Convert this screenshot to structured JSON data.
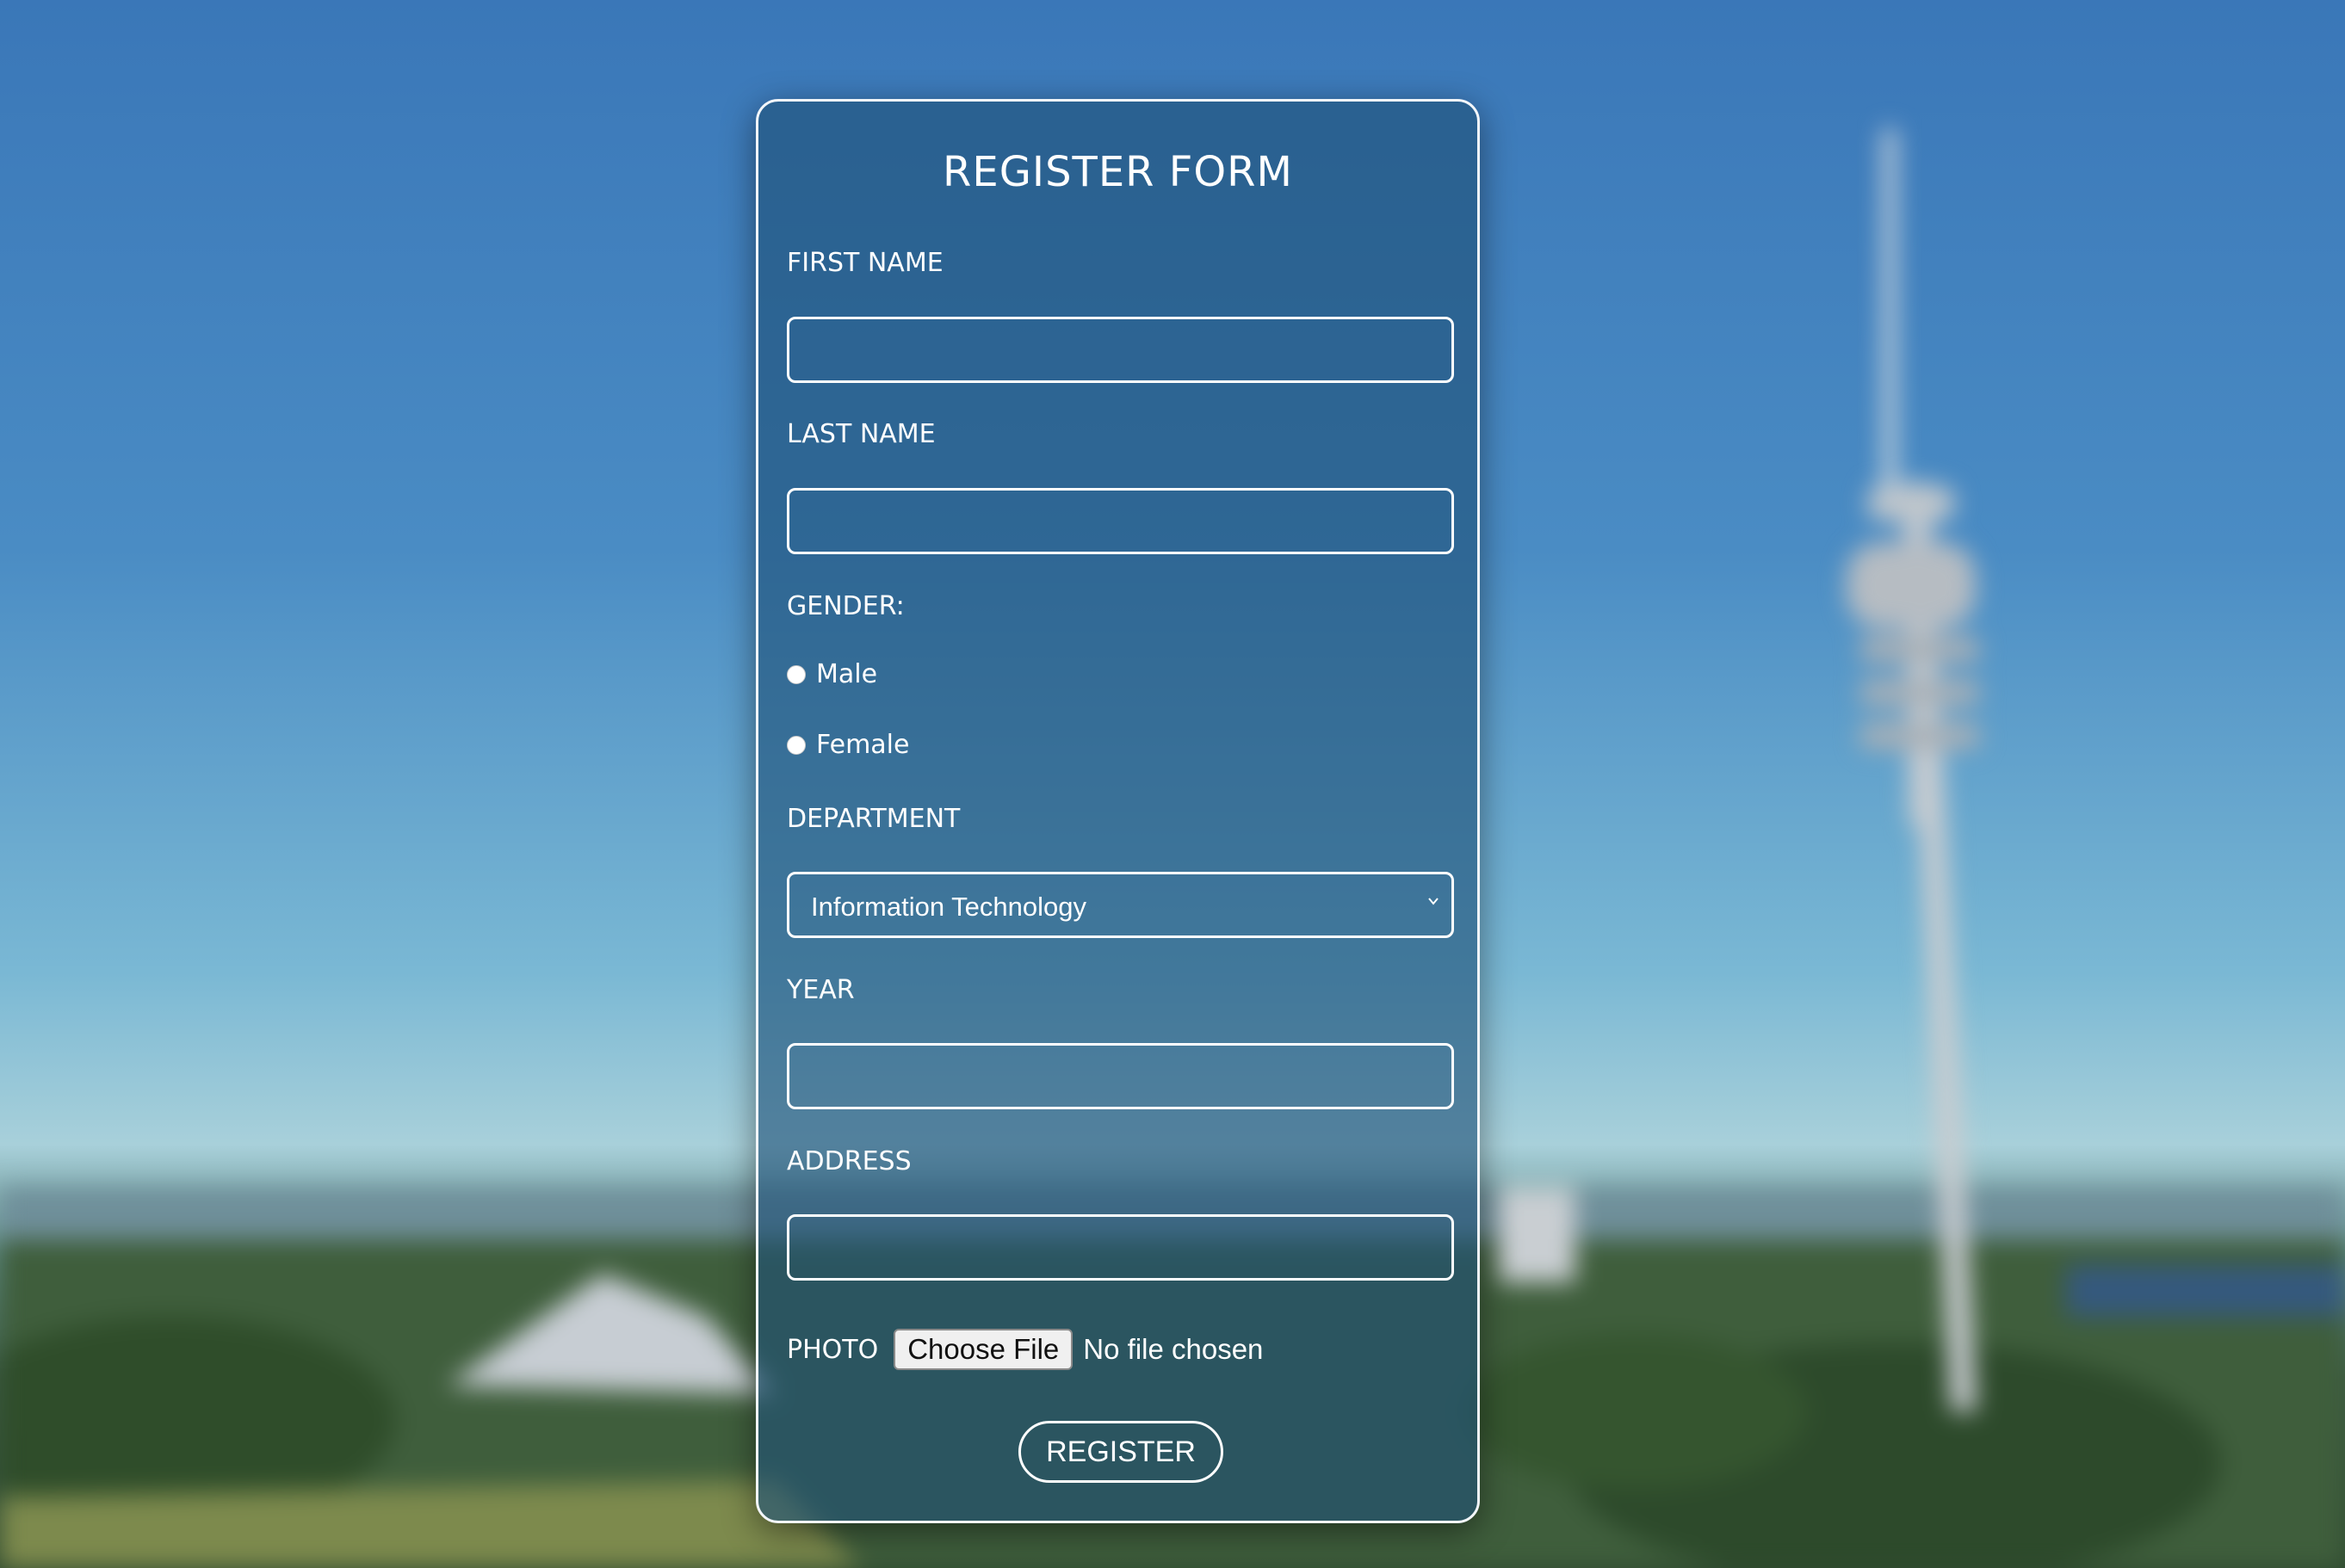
{
  "form": {
    "title": "REGISTER FORM",
    "first_name_label": "FIRST NAME",
    "first_name_value": "",
    "last_name_label": "LAST NAME",
    "last_name_value": "",
    "gender_label": "GENDER:",
    "gender_options": [
      "Male",
      "Female"
    ],
    "department_label": "DEPARTMENT",
    "department_selected": "Information Technology",
    "year_label": "YEAR",
    "year_value": "",
    "address_label": "ADDRESS",
    "address_value": "",
    "photo_label": "PHOTO",
    "file_button_label": "Choose File",
    "file_status": "No file chosen",
    "register_label": "REGISTER"
  },
  "icons": {
    "select_arrow": "chevron-down-icon"
  },
  "colors": {
    "card_border": "#f2f6fa",
    "text": "#ffffff",
    "sky": "#3a77b8"
  }
}
